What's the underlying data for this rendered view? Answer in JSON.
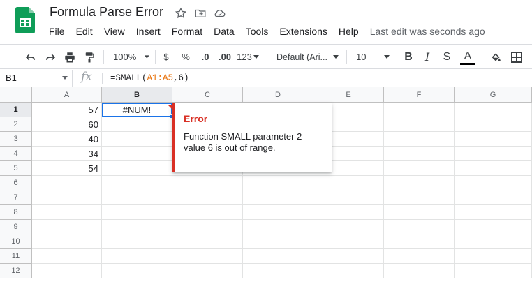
{
  "app": {
    "doc_title": "Formula Parse Error",
    "menu": [
      "File",
      "Edit",
      "View",
      "Insert",
      "Format",
      "Data",
      "Tools",
      "Extensions",
      "Help"
    ],
    "last_edit": "Last edit was seconds ago"
  },
  "toolbar": {
    "zoom": "100%",
    "currency": "$",
    "percent": "%",
    "decrease_decimal": ".0",
    "increase_decimal": ".00",
    "more_formats": "123",
    "font": "Default (Ari...",
    "font_size": "10",
    "bold": "B",
    "italic": "I",
    "strikethrough": "S",
    "text_color_letter": "A",
    "text_color": "#000000"
  },
  "formula_bar": {
    "name_box": "B1",
    "fx": "fx",
    "formula_prefix": "=SMALL(",
    "formula_ref": "A1:A5",
    "formula_suffix": ",6)"
  },
  "grid": {
    "columns": [
      "A",
      "B",
      "C",
      "D",
      "E",
      "F",
      "G"
    ],
    "rows": [
      "1",
      "2",
      "3",
      "4",
      "5",
      "6",
      "7",
      "8",
      "9",
      "10",
      "11",
      "12"
    ],
    "column_a_values": [
      "57",
      "60",
      "40",
      "34",
      "54"
    ],
    "b1_value": "#NUM!",
    "selected_cell": "B1"
  },
  "error_popup": {
    "title": "Error",
    "message": "Function SMALL parameter 2 value 6 is out of range.",
    "accent_color": "#d93025"
  },
  "colors": {
    "brand_green": "#0f9d58",
    "selection_blue": "#1a73e8",
    "error_red": "#d93025"
  }
}
